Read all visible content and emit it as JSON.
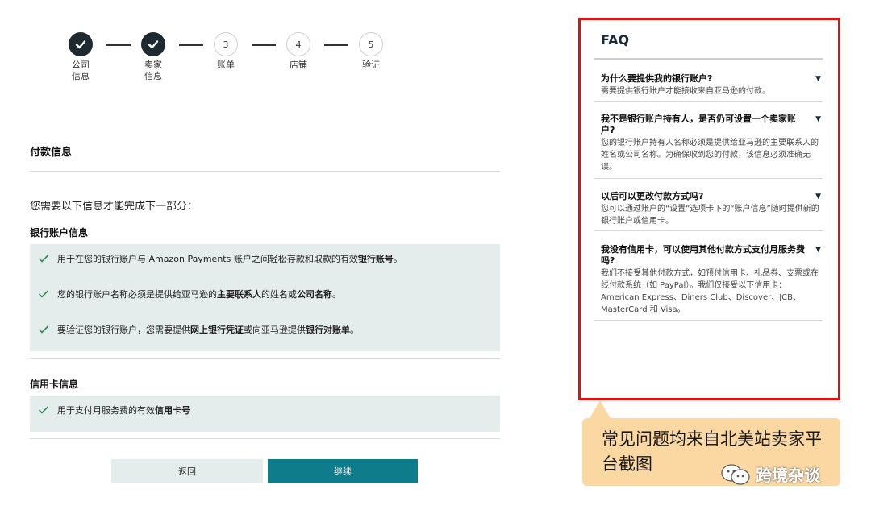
{
  "stepper": {
    "steps": [
      {
        "label_line1": "公司",
        "label_line2": "信息",
        "state": "done"
      },
      {
        "label_line1": "卖家",
        "label_line2": "信息",
        "state": "done"
      },
      {
        "number": "3",
        "label_line1": "账单",
        "state": "todo"
      },
      {
        "number": "4",
        "label_line1": "店铺",
        "state": "todo"
      },
      {
        "number": "5",
        "label_line1": "验证",
        "state": "todo"
      }
    ]
  },
  "main": {
    "section_title": "付款信息",
    "intro": "您需要以下信息才能完成下一部分：",
    "bank": {
      "title": "银行账户信息",
      "items": [
        {
          "pre": "用于在您的银行账户与 Amazon Payments 账户之间轻松存款和取款的有效",
          "bold": "银行账号",
          "post": "。"
        },
        {
          "pre": "您的银行账户名称必须是提供给亚马逊的",
          "bold": "主要联系人",
          "mid": "的姓名或",
          "bold2": "公司名称",
          "post": "。"
        },
        {
          "pre": "要验证您的银行账户，您需要提供",
          "bold": "网上银行凭证",
          "mid": "或向亚马逊提供",
          "bold2": "银行对账单",
          "post": "。"
        }
      ]
    },
    "card": {
      "title": "信用卡信息",
      "items": [
        {
          "pre": "用于支付月服务费的有效",
          "bold": "信用卡号",
          "post": ""
        }
      ]
    },
    "buttons": {
      "back": "返回",
      "continue": "继续"
    }
  },
  "faq": {
    "title": "FAQ",
    "items": [
      {
        "q": "为什么要提供我的银行账户?",
        "a": "需要提供银行账户才能接收来自亚马逊的付款。"
      },
      {
        "q": "我不是银行账户持有人，是否仍可设置一个卖家账户?",
        "a": "您的银行账户持有人名称必须是提供给亚马逊的主要联系人的姓名或公司名称。为确保收到您的付款，该信息必须准确无误。"
      },
      {
        "q": "以后可以更改付款方式吗?",
        "a": "您可以通过账户的“设置”选项卡下的“账户信息”随时提供新的银行账户或信用卡。"
      },
      {
        "q": "我没有信用卡，可以使用其他付款方式支付月服务费吗?",
        "a": "我们不接受其他付款方式，如预付信用卡、礼品券、支票或在线付款系统（如 PayPal）。我们仅接受以下信用卡：American Express、Diners Club、Discover、JCB、MasterCard 和 Visa。"
      }
    ]
  },
  "callout": {
    "text": "常见问题均来自北美站卖家平台截图"
  },
  "watermark": {
    "text": "跨境杂谈"
  },
  "colors": {
    "accent": "#0e7c8a",
    "check": "#2e8b57",
    "highlight_border": "#e01010",
    "callout_bg": "#fbd7a1",
    "panel_bg": "#e4ecec"
  }
}
